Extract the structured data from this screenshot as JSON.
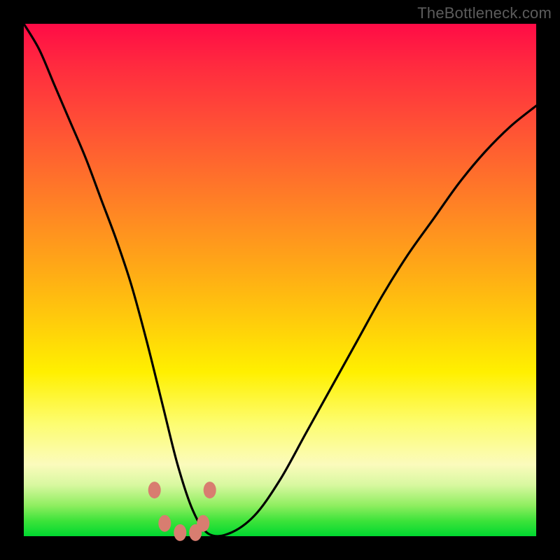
{
  "watermark": "TheBottleneck.com",
  "colors": {
    "frame": "#000000",
    "curve_stroke": "#000000",
    "dot_fill": "#d87d70",
    "gradient_top": "#ff0b46",
    "gradient_bottom": "#00d830"
  },
  "chart_data": {
    "type": "line",
    "title": "",
    "xlabel": "",
    "ylabel": "",
    "xlim": [
      0,
      100
    ],
    "ylim": [
      0,
      100
    ],
    "grid": false,
    "legend": false,
    "annotations": [
      "TheBottleneck.com"
    ],
    "series": [
      {
        "name": "bottleneck-curve",
        "x": [
          0,
          3,
          6,
          9,
          12,
          15,
          18,
          21,
          24,
          27,
          30,
          33,
          36,
          40,
          45,
          50,
          55,
          60,
          65,
          70,
          75,
          80,
          85,
          90,
          95,
          100
        ],
        "y": [
          100,
          95,
          88,
          81,
          74,
          66,
          58,
          49,
          38,
          26,
          14,
          5,
          0.5,
          0.5,
          4,
          11,
          20,
          29,
          38,
          47,
          55,
          62,
          69,
          75,
          80,
          84
        ]
      }
    ],
    "markers": [
      {
        "x": 25.5,
        "y": 9
      },
      {
        "x": 27.5,
        "y": 2.5
      },
      {
        "x": 30.5,
        "y": 0.7
      },
      {
        "x": 33.5,
        "y": 0.7
      },
      {
        "x": 35.0,
        "y": 2.5
      },
      {
        "x": 36.3,
        "y": 9
      }
    ]
  }
}
